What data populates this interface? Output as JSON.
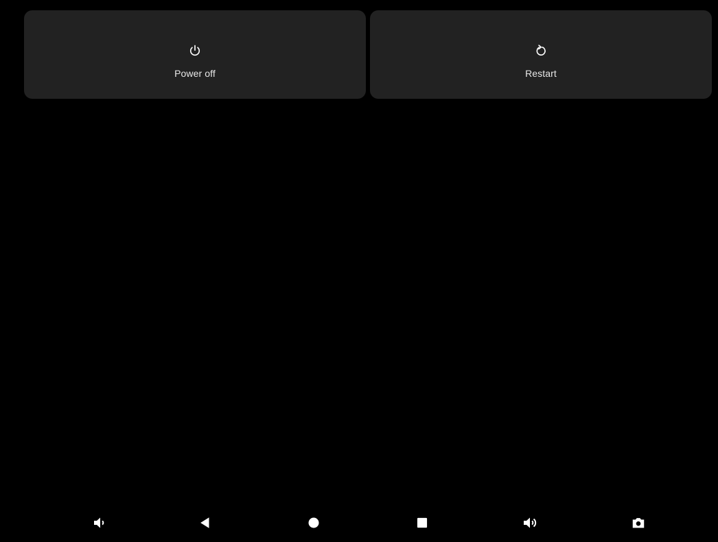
{
  "power_menu": {
    "actions": [
      {
        "id": "power-off",
        "label": "Power off",
        "icon": "power-icon"
      },
      {
        "id": "restart",
        "label": "Restart",
        "icon": "restart-icon"
      }
    ],
    "card_color": "#222222",
    "text_color": "#e8e8e8"
  },
  "nav_bar": {
    "buttons": [
      {
        "id": "volume-down",
        "icon": "volume-down-icon"
      },
      {
        "id": "back",
        "icon": "back-icon"
      },
      {
        "id": "home",
        "icon": "home-icon"
      },
      {
        "id": "recents",
        "icon": "recents-icon"
      },
      {
        "id": "volume-up",
        "icon": "volume-up-icon"
      },
      {
        "id": "screenshot",
        "icon": "camera-icon"
      }
    ],
    "icon_color": "#ffffff"
  }
}
